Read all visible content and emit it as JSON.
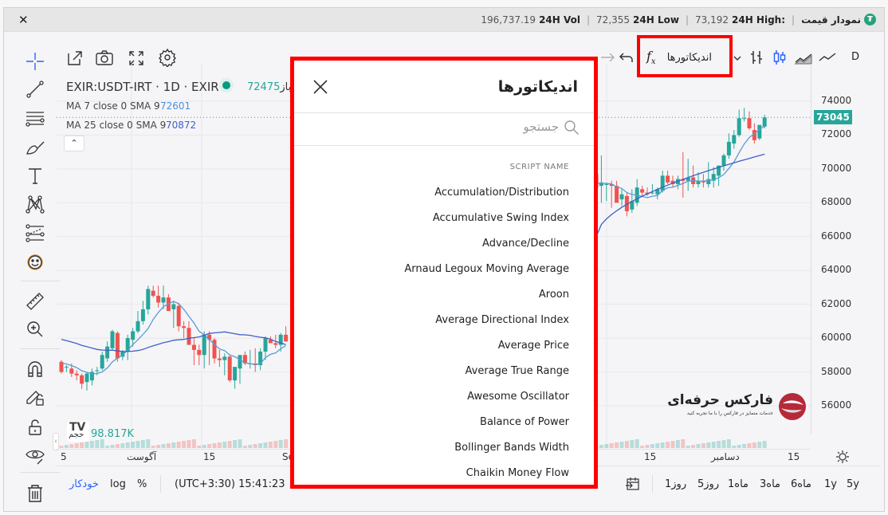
{
  "window": {
    "close_label": "✕"
  },
  "header": {
    "title": "نمودار قیمت",
    "stats": [
      {
        "label": "24H High:",
        "value": "73,192"
      },
      {
        "label": "24H Low",
        "value": "72,355"
      },
      {
        "label": "24H Vol",
        "value": "196,737.19"
      }
    ]
  },
  "toolbar": {
    "interval": "D",
    "indicators_label": "اندیکاتورها",
    "icons": [
      "external-link-icon",
      "camera-icon",
      "fullscreen-icon",
      "settings-icon",
      "undo-icon",
      "redo-icon",
      "bars-chart-icon",
      "candles-chart-icon",
      "area-chart-icon",
      "line-chart-icon",
      "fx-icon"
    ]
  },
  "legend": {
    "symbol": "EXIR:USDT-IRT · 1D · EXIR",
    "open_label": "باز",
    "open_value": "72475",
    "ma7_label": "MA 7 close 0 SMA 9",
    "ma7_value": "72601",
    "ma25_label": "MA 25 close 0 SMA 9",
    "ma25_value": "70872"
  },
  "price_axis": {
    "ticks": [
      "74000",
      "72000",
      "70000",
      "68000",
      "66000",
      "64000",
      "62000",
      "60000",
      "58000",
      "56000"
    ],
    "current_price": "73045"
  },
  "time_axis": {
    "ticks": [
      "5",
      "آگوست",
      "15",
      "Se",
      "15",
      "دسامبر",
      "15"
    ]
  },
  "volume": {
    "label": "حجم",
    "value": "98.817K"
  },
  "watermark": {
    "brand": "فارکس حرفه‌ای",
    "tagline": "خدمات متمایز در فارکس را با ما تجربه کنید"
  },
  "bottom_bar": {
    "auto_label": "خودکار",
    "log_label": "log",
    "percent_label": "%",
    "clock": "(UTC+3:30) 15:41:23",
    "ranges": [
      "5y",
      "1y",
      "6ماه",
      "3ماه",
      "1ماه",
      "5روز",
      "1روز"
    ]
  },
  "indicators_modal": {
    "title": "اندیکاتورها",
    "search_placeholder": "جستجو",
    "column_header": "SCRIPT NAME",
    "items": [
      "Accumulation/Distribution",
      "Accumulative Swing Index",
      "Advance/Decline",
      "Arnaud Legoux Moving Average",
      "Aroon",
      "Average Directional Index",
      "Average Price",
      "Average True Range",
      "Awesome Oscillator",
      "Balance of Power",
      "Bollinger Bands Width",
      "Chaikin Money Flow"
    ]
  },
  "colors": {
    "up": "#26a69a",
    "down": "#ef5350",
    "ma7": "#5b9bd5",
    "ma25": "#3f5fc8",
    "highlight": "#ff0000",
    "accent": "#2962ff"
  },
  "chart_data": {
    "type": "candlestick",
    "price_range": [
      55000,
      75000
    ],
    "left_visible_candles": [
      [
        58600,
        58700,
        57900,
        58000
      ],
      [
        58300,
        58400,
        58000,
        58300
      ],
      [
        58200,
        58500,
        57700,
        57900
      ],
      [
        57900,
        58100,
        57500,
        57800
      ],
      [
        57800,
        57900,
        57000,
        57300
      ],
      [
        57400,
        58000,
        56900,
        57900
      ],
      [
        57500,
        58200,
        57200,
        58000
      ],
      [
        58100,
        58300,
        57800,
        58100
      ],
      [
        58200,
        59200,
        58100,
        59000
      ],
      [
        58800,
        59800,
        58600,
        59500
      ],
      [
        59400,
        60500,
        59300,
        60400
      ],
      [
        60300,
        60400,
        58600,
        58800
      ],
      [
        58900,
        59300,
        58700,
        59200
      ],
      [
        59200,
        60200,
        58700,
        60000
      ],
      [
        59900,
        60600,
        59500,
        60400
      ],
      [
        60400,
        61600,
        60300,
        61000
      ],
      [
        61000,
        62200,
        60800,
        61700
      ],
      [
        61700,
        63100,
        61400,
        62900
      ],
      [
        62800,
        63100,
        62400,
        62500
      ],
      [
        62500,
        63100,
        61800,
        62100
      ],
      [
        62100,
        63100,
        61700,
        62400
      ],
      [
        62400,
        62600,
        61600,
        61600
      ],
      [
        61700,
        62200,
        60600,
        62000
      ],
      [
        61900,
        62100,
        60400,
        60700
      ],
      [
        60700,
        61000,
        60000,
        60600
      ],
      [
        60600,
        61000,
        59600,
        59600
      ],
      [
        59600,
        60000,
        58400,
        59300
      ],
      [
        59300,
        59600,
        58400,
        59000
      ],
      [
        59000,
        60400,
        58200,
        60200
      ],
      [
        60200,
        60400,
        58400,
        59900
      ],
      [
        59900,
        60000,
        58500,
        58800
      ],
      [
        58800,
        59300,
        58300,
        58700
      ],
      [
        58700,
        59100,
        57800,
        58900
      ],
      [
        58900,
        59000,
        57400,
        57500
      ],
      [
        57500,
        58200,
        57000,
        58300
      ],
      [
        58200,
        58900,
        57300,
        59000
      ],
      [
        59000,
        59200,
        58400,
        58500
      ],
      [
        58500,
        59300,
        58200,
        58500
      ],
      [
        58500,
        59400,
        58000,
        58400
      ],
      [
        58400,
        59400,
        58100,
        59200
      ],
      [
        59200,
        60100,
        58700,
        60000
      ],
      [
        59900,
        60100,
        59700,
        59700
      ],
      [
        59700,
        60200,
        59400,
        59600
      ],
      [
        59600,
        60300,
        59200,
        60200
      ],
      [
        60200,
        60700,
        59800,
        59800
      ]
    ],
    "right_visible_candles": [
      [
        69700,
        70400,
        68400,
        68900
      ],
      [
        69000,
        70800,
        68000,
        69200
      ],
      [
        69100,
        69200,
        68100,
        69100
      ],
      [
        69100,
        69300,
        67700,
        69000
      ],
      [
        69000,
        69300,
        68200,
        68000
      ],
      [
        68200,
        68800,
        67800,
        68500
      ],
      [
        68400,
        68600,
        67200,
        67500
      ],
      [
        67600,
        68800,
        67400,
        68100
      ],
      [
        68000,
        69400,
        67800,
        68900
      ],
      [
        68800,
        69000,
        68400,
        68600
      ],
      [
        68600,
        68900,
        68400,
        68500
      ],
      [
        68600,
        69100,
        68500,
        68600
      ],
      [
        68500,
        68900,
        68200,
        68800
      ],
      [
        68700,
        69900,
        68600,
        69600
      ],
      [
        69600,
        69900,
        69100,
        69200
      ],
      [
        69300,
        69600,
        68900,
        69100
      ],
      [
        69100,
        69600,
        68800,
        69400
      ],
      [
        69400,
        71000,
        68300,
        69300
      ],
      [
        69300,
        70600,
        68700,
        69500
      ],
      [
        69500,
        70200,
        68900,
        69100
      ],
      [
        69100,
        69800,
        68900,
        69300
      ],
      [
        69300,
        69700,
        68900,
        69200
      ],
      [
        69100,
        70400,
        68900,
        69400
      ],
      [
        69300,
        70100,
        68900,
        69700
      ],
      [
        69600,
        70000,
        69000,
        70200
      ],
      [
        70200,
        70900,
        69900,
        70800
      ],
      [
        70800,
        72100,
        70600,
        71600
      ],
      [
        71500,
        72300,
        71200,
        72000
      ],
      [
        72000,
        73500,
        71900,
        73000
      ],
      [
        73000,
        73600,
        72800,
        73000
      ],
      [
        73000,
        73400,
        72300,
        72400
      ],
      [
        72300,
        72700,
        71500,
        71700
      ],
      [
        71800,
        72600,
        71700,
        72600
      ],
      [
        72500,
        73200,
        72400,
        73045
      ]
    ],
    "ma7_label": "MA 7",
    "ma25_label": "MA 25"
  }
}
